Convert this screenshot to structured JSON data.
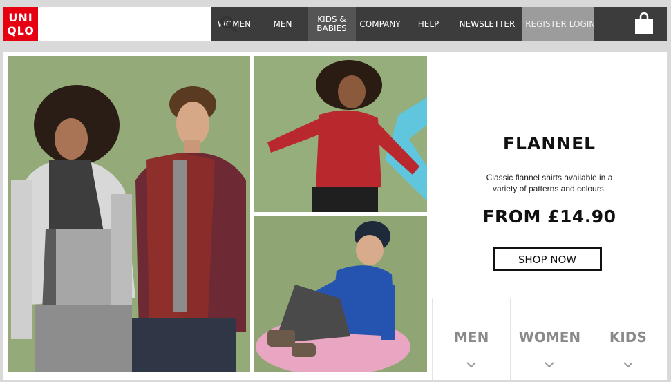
{
  "brand": {
    "logo_line1": "UNI",
    "logo_line2": "QLO",
    "color": "#e60012"
  },
  "search": {
    "placeholder": "",
    "icon": "search-icon"
  },
  "nav": {
    "primary": [
      {
        "label": "WOMEN"
      },
      {
        "label": "MEN"
      },
      {
        "label": "KIDS & BABIES"
      },
      {
        "label": "COMPANY"
      },
      {
        "label": "HELP"
      },
      {
        "label": "NEWSLETTER"
      }
    ],
    "account": [
      {
        "label": "REGISTER"
      },
      {
        "label": "LOGIN"
      }
    ],
    "bag_icon": "shopping-bag-icon"
  },
  "promo": {
    "title": "FLANNEL",
    "description": "Classic flannel shirts available in a variety of patterns and colours.",
    "price": "FROM £14.90",
    "cta": "SHOP NOW"
  },
  "categories": [
    {
      "label": "MEN"
    },
    {
      "label": "WOMEN"
    },
    {
      "label": "KIDS"
    }
  ],
  "colors": {
    "nav_dark": "#3c3c3c",
    "nav_light": "#9c9c9c",
    "category_text": "#8a8a8a"
  }
}
